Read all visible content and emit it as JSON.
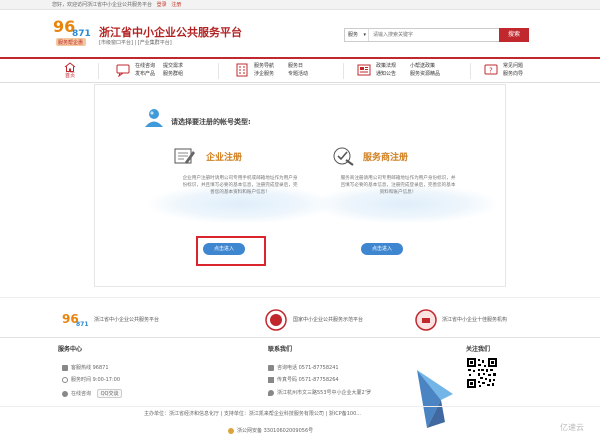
{
  "topbar": {
    "greeting": "您好，欢迎访问浙江省中小企业公共服务平台",
    "login": "登录",
    "register": "注册"
  },
  "header": {
    "title": "浙江省中小企业公共服务平台",
    "sub_links": "[市级窗口平台] | [产业集群平台]",
    "logo_number": "96871",
    "logo_tagline": "服务帮企惠"
  },
  "search": {
    "category": "服务",
    "placeholder": "请输入搜索关键字",
    "button": "搜索"
  },
  "nav": {
    "home": "首页",
    "groups": [
      {
        "r1": [
          "在线咨询",
          "提交需求"
        ],
        "r2": [
          "发布产品",
          "服务群组"
        ]
      },
      {
        "r1": [
          "服务导航",
          "服务日"
        ],
        "r2": [
          "涉企服务",
          "专题活动"
        ]
      },
      {
        "r1": [
          "政策法规",
          "小帮送政策"
        ],
        "r2": [
          "通知公告",
          "服务资源精品"
        ]
      },
      {
        "r1": [
          "常见问题"
        ],
        "r2": [
          "服务向导"
        ]
      }
    ]
  },
  "main": {
    "prompt": "请选择要注册的帐号类型:",
    "enterprise": {
      "title": "企业注册",
      "desc": "企业用户注册时请用公司专用手机或邮箱地址作为用户身份标识，并且填写必要的基本信息，注册完成登录后，完善您的基本资料和账户信息！",
      "button": "点击进入"
    },
    "provider": {
      "title": "服务商注册",
      "desc": "服务商注册请用公司专用邮箱地址作为用户身份标识，并且填写必要的基本信息，注册完成登录后，完善您的基本资料和账户信息！",
      "button": "点击进入"
    }
  },
  "partners": [
    {
      "name": "浙江省中小企业公共服务平台"
    },
    {
      "name": "国家中小企业公共服务示范平台"
    },
    {
      "name": "浙江省中小企业十佳服务机构"
    }
  ],
  "footer": {
    "service_center": {
      "title": "服务中心",
      "hotline": "客服热线 96871",
      "hours": "服务时间 9:00-17:00",
      "online": "在线咨询",
      "qq": "QQ交谈"
    },
    "contact": {
      "title": "联系我们",
      "tel": "咨询电话 0571-87758241",
      "fax": "传真号码 0571-87758264",
      "address": "浙江杭州市文三路553号中小企业大厦2'罗"
    },
    "follow": {
      "title": "关注我们"
    },
    "sponsor": "主办单位：浙江省经济和信息化厅 | 支持单位：浙江凯来帮企业科技服务有限公司 | 浙ICP备100...",
    "police": "浙公网安备 33010602009056号"
  },
  "watermark": {
    "text": "亿速云"
  }
}
